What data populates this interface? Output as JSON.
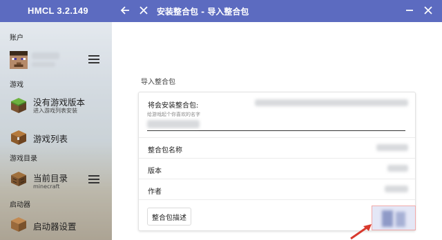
{
  "window": {
    "app_title": "HMCL 3.2.149",
    "page_title": "安装整合包 - 导入整合包"
  },
  "sidebar": {
    "section_account": "账户",
    "section_game": "游戏",
    "no_version_title": "没有游戏版本",
    "no_version_subtitle": "进入游戏列表安装",
    "game_list": "游戏列表",
    "section_game_dir": "游戏目录",
    "current_dir_title": "当前目录",
    "current_dir_subtitle": "minecraft",
    "section_launcher": "启动器",
    "launcher_settings": "启动器设置"
  },
  "main": {
    "heading": "导入整合包",
    "rows": {
      "to_install_label": "将会安装整合包:",
      "name_hint": "给游戏起个你喜欢的名字",
      "pack_name_label": "整合包名称",
      "version_label": "版本",
      "author_label": "作者"
    },
    "description_button": "整合包描述"
  },
  "colors": {
    "titlebar": "#5c6bc0",
    "arrow": "#d83a2e"
  },
  "icons": {
    "back": "arrow-left",
    "close": "x",
    "minimize": "minus",
    "window_close": "x"
  }
}
